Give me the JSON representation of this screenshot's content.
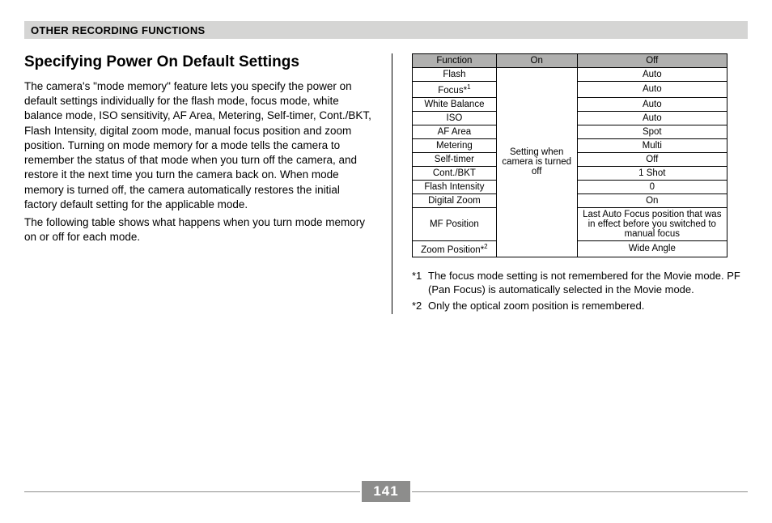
{
  "sectionTitle": "OTHER RECORDING FUNCTIONS",
  "heading": "Specifying Power On Default Settings",
  "para1": "The camera's \"mode memory\" feature lets you specify the power on default settings individually for the flash mode, focus mode, white balance mode, ISO sensitivity, AF Area, Metering, Self-timer, Cont./BKT, Flash Intensity, digital zoom mode, manual focus position and zoom position. Turning on mode memory for a mode tells the camera to remember the status of that mode when you turn off the camera, and restore it the next time you turn the camera back on. When mode memory is turned off, the camera automatically restores the initial factory default setting for the applicable mode.",
  "para2": "The following table shows what happens when you turn mode memory on or off for each mode.",
  "table": {
    "headers": {
      "function": "Function",
      "on": "On",
      "off": "Off"
    },
    "onMerged": "Setting when camera is turned off",
    "rows": [
      {
        "fn": "Flash",
        "off": "Auto"
      },
      {
        "fn": "Focus",
        "sup": "1",
        "off": "Auto"
      },
      {
        "fn": "White Balance",
        "off": "Auto"
      },
      {
        "fn": "ISO",
        "off": "Auto"
      },
      {
        "fn": "AF Area",
        "off": "Spot"
      },
      {
        "fn": "Metering",
        "off": "Multi"
      },
      {
        "fn": "Self-timer",
        "off": "Off"
      },
      {
        "fn": "Cont./BKT",
        "off": "1 Shot"
      },
      {
        "fn": "Flash Intensity",
        "off": "0"
      },
      {
        "fn": "Digital Zoom",
        "off": "On"
      },
      {
        "fn": "MF Position",
        "off": "Last Auto Focus position that was in effect before you switched to manual focus"
      },
      {
        "fn": "Zoom Position",
        "sup": "2",
        "off": "Wide Angle"
      }
    ]
  },
  "notes": [
    {
      "marker": "*1",
      "text": "The focus mode setting is not remembered for the Movie mode. PF (Pan Focus) is automatically selected in the Movie mode."
    },
    {
      "marker": "*2",
      "text": "Only the optical zoom position is remembered."
    }
  ],
  "pageNumber": "141"
}
